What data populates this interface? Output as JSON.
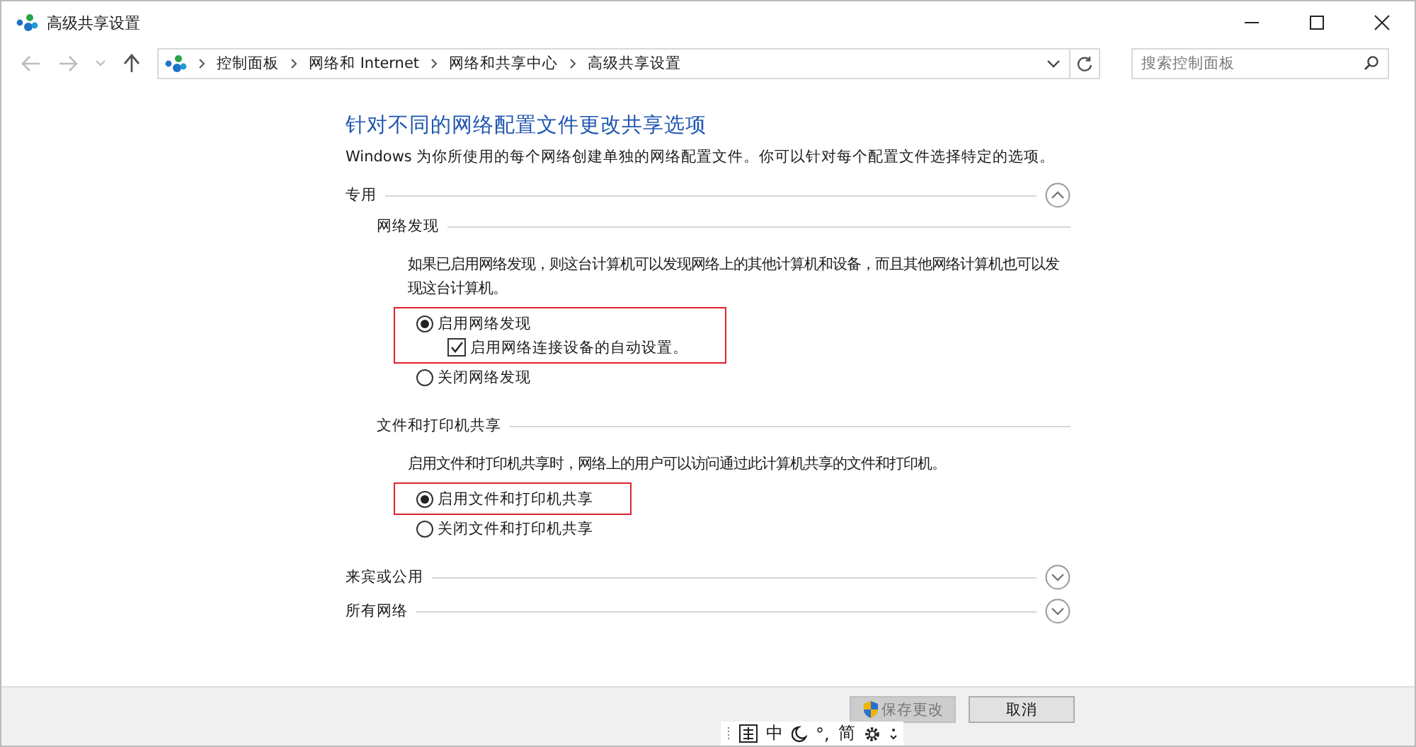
{
  "window": {
    "title": "高级共享设置"
  },
  "address_bar": {
    "breadcrumb": [
      "控制面板",
      "网络和 Internet",
      "网络和共享中心",
      "高级共享设置"
    ]
  },
  "search": {
    "placeholder": "搜索控制面板"
  },
  "heading": "针对不同的网络配置文件更改共享选项",
  "intro": "Windows 为你所使用的每个网络创建单独的网络配置文件。你可以针对每个配置文件选择特定的选项。",
  "sections": [
    {
      "title": "专用",
      "expanded": true,
      "subsections": [
        {
          "title": "网络发现",
          "description": "如果已启用网络发现，则这台计算机可以发现网络上的其他计算机和设备，而且其他网络计算机也可以发现这台计算机。",
          "options": [
            {
              "label": "启用网络发现",
              "selected": true,
              "highlighted": true,
              "children": [
                {
                  "label": "启用网络连接设备的自动设置。",
                  "checked": true
                }
              ]
            },
            {
              "label": "关闭网络发现",
              "selected": false,
              "highlighted": false
            }
          ]
        },
        {
          "title": "文件和打印机共享",
          "description": "启用文件和打印机共享时，网络上的用户可以访问通过此计算机共享的文件和打印机。",
          "options": [
            {
              "label": "启用文件和打印机共享",
              "selected": true,
              "highlighted": true
            },
            {
              "label": "关闭文件和打印机共享",
              "selected": false,
              "highlighted": false
            }
          ]
        }
      ]
    },
    {
      "title": "来宾或公用",
      "expanded": false
    },
    {
      "title": "所有网络",
      "expanded": false
    }
  ],
  "buttons": [
    {
      "label": "保存更改",
      "disabled": true,
      "kind": "shield"
    },
    {
      "label": "取消",
      "disabled": false,
      "kind": "plain"
    }
  ],
  "ime_bar": {
    "items": [
      "中",
      "°,",
      "简"
    ]
  }
}
